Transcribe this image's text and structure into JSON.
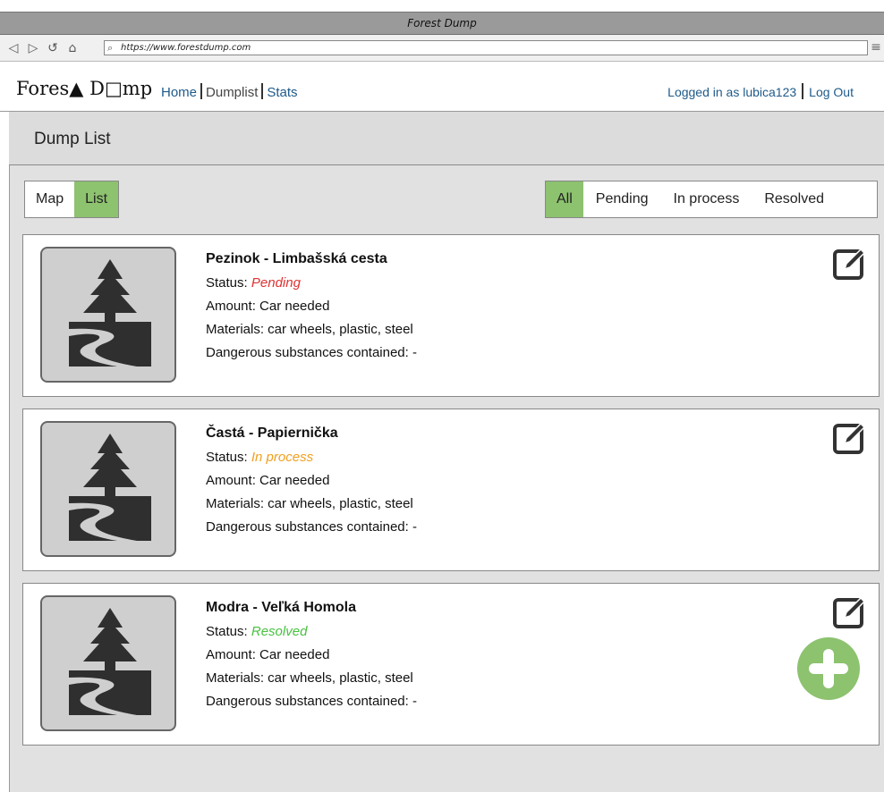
{
  "window": {
    "title": "Forest Dump"
  },
  "browser": {
    "url": "https://www.forestdump.com"
  },
  "header": {
    "logo": "Fores▲ D□mp",
    "nav": [
      "Home",
      "Dumplist",
      "Stats"
    ],
    "user": "Logged in as lubica123",
    "logout": "Log Out"
  },
  "page": {
    "title": "Dump List"
  },
  "view_toggle": [
    "Map",
    "List"
  ],
  "filters": [
    "All",
    "Pending",
    "In process",
    "Resolved"
  ],
  "dumps": [
    {
      "title": "Pezinok - Limbašská cesta",
      "status_label": "Status:",
      "status": "Pending",
      "amount": "Amount: Car needed",
      "materials": "Materials:  car wheels, plastic, steel",
      "dangerous": "Dangerous substances contained:  -"
    },
    {
      "title": "Častá - Papiernička",
      "status_label": "Status:",
      "status": "In process",
      "amount": "Amount: Car needed",
      "materials": "Materials:  car wheels, plastic, steel",
      "dangerous": "Dangerous substances contained:  -"
    },
    {
      "title": "Modra - Veľká Homola",
      "status_label": "Status:",
      "status": "Resolved",
      "amount": "Amount: Car needed",
      "materials": "Materials:  car wheels, plastic, steel",
      "dangerous": "Dangerous substances contained:  -"
    }
  ],
  "colors": {
    "accent": "#8dc26f",
    "pending": "#e03131",
    "in_process": "#f0a020",
    "resolved": "#47c23f"
  },
  "icons": [
    "back-icon",
    "forward-icon",
    "refresh-icon",
    "home-icon",
    "search-icon",
    "menu-icon",
    "tree-logo-icon",
    "edit-icon",
    "add-icon",
    "tree-road-icon"
  ]
}
